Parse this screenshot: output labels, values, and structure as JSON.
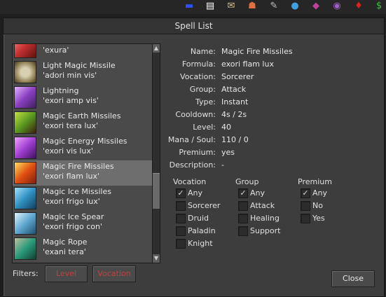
{
  "window": {
    "title": "Spell List"
  },
  "spells": [
    {
      "name": "",
      "words": "'exura'",
      "icon": "heal-icon",
      "color": "#c03030"
    },
    {
      "name": "Light Magic Missile",
      "words": "'adori min vis'",
      "icon": "rune-icon",
      "color": "#8a7a50"
    },
    {
      "name": "Lightning",
      "words": "'exori amp vis'",
      "icon": "lightning-icon",
      "color": "#8a40c0"
    },
    {
      "name": "Magic Earth Missiles",
      "words": "'exori tera lux'",
      "icon": "earth-icon",
      "color": "#5a9a20"
    },
    {
      "name": "Magic Energy Missiles",
      "words": "'exori vis lux'",
      "icon": "energy-icon",
      "color": "#a040d0"
    },
    {
      "name": "Magic Fire Missiles",
      "words": "'exori flam lux'",
      "icon": "fire-icon",
      "color": "#e05010"
    },
    {
      "name": "Magic Ice Missiles",
      "words": "'exori frigo lux'",
      "icon": "ice-icon",
      "color": "#3090c0"
    },
    {
      "name": "Magic Ice Spear",
      "words": "'exori frigo con'",
      "icon": "ice-spear-icon",
      "color": "#60a8d0"
    },
    {
      "name": "Magic Rope",
      "words": "'exani tera'",
      "icon": "rope-icon",
      "color": "#2a9a7a"
    },
    {
      "name": "",
      "words": "",
      "icon": "partial-icon",
      "color": "#3aa0a0"
    }
  ],
  "details": {
    "labels": {
      "name": "Name:",
      "formula": "Formula:",
      "vocation": "Vocation:",
      "group": "Group:",
      "type": "Type:",
      "cooldown": "Cooldown:",
      "level": "Level:",
      "mana": "Mana / Soul:",
      "premium": "Premium:",
      "description": "Description:"
    },
    "values": {
      "name": "Magic Fire Missiles",
      "formula": "exori flam lux",
      "vocation": "Sorcerer",
      "group": "Attack",
      "type": "Instant",
      "cooldown": "4s / 2s",
      "level": "40",
      "mana": "110 / 0",
      "premium": "yes",
      "description": "-"
    }
  },
  "filters": {
    "vocation": {
      "title": "Vocation",
      "options": [
        {
          "label": "Any",
          "checked": true
        },
        {
          "label": "Sorcerer",
          "checked": false
        },
        {
          "label": "Druid",
          "checked": false
        },
        {
          "label": "Paladin",
          "checked": false
        },
        {
          "label": "Knight",
          "checked": false
        }
      ]
    },
    "group": {
      "title": "Group",
      "options": [
        {
          "label": "Any",
          "checked": true
        },
        {
          "label": "Attack",
          "checked": false
        },
        {
          "label": "Healing",
          "checked": false
        },
        {
          "label": "Support",
          "checked": false
        }
      ]
    },
    "premium": {
      "title": "Premium",
      "options": [
        {
          "label": "Any",
          "checked": true
        },
        {
          "label": "No",
          "checked": false
        },
        {
          "label": "Yes",
          "checked": false
        }
      ]
    }
  },
  "bottom": {
    "filters_label": "Filters:",
    "level_button": "Level",
    "vocation_button": "Vocation",
    "close_button": "Close"
  },
  "colors": {
    "filter_button_text": "#c84040",
    "selected_row": "#6e6e6e"
  }
}
